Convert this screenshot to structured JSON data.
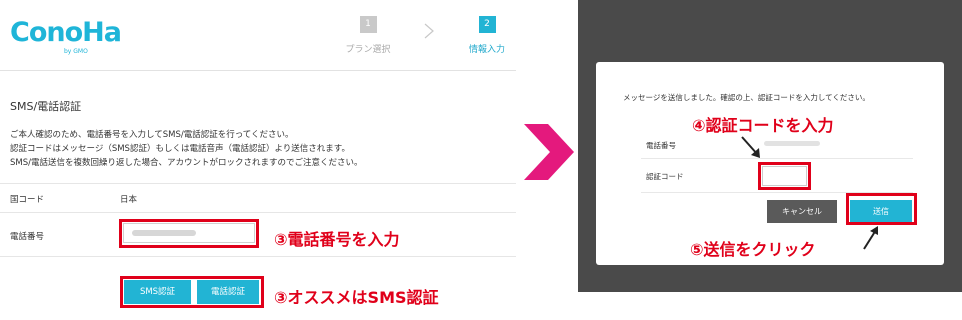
{
  "logo": {
    "text": "ConoHa",
    "sub": "by GMO"
  },
  "steps": [
    {
      "number": "1",
      "label": "プラン選択",
      "active": false
    },
    {
      "number": "2",
      "label": "情報入力",
      "active": true
    }
  ],
  "section_title": "SMS/電話認証",
  "description": [
    "ご本人確認のため、電話番号を入力してSMS/電話認証を行ってください。",
    "認証コードはメッセージ（SMS認証）もしくは電話音声（電話認証）より送信されます。",
    "SMS/電話送信を複数回繰り返した場合、アカウントがロックされますのでご注意ください。"
  ],
  "country": {
    "label": "国コード",
    "value": "日本"
  },
  "phone": {
    "label": "電話番号"
  },
  "auth_buttons": {
    "sms": "SMS認証",
    "phone": "電話認証"
  },
  "annotations": {
    "a3_phone": "③電話番号を入力",
    "a3_sms": "③オススメはSMS認証",
    "a4_code": "④認証コードを入力",
    "a5_send": "⑤送信をクリック"
  },
  "modal": {
    "message": "メッセージを送信しました。確認の上、認証コードを入力してください。",
    "phone_label": "電話番号",
    "code_label": "認証コード",
    "cancel": "キャンセル",
    "send": "送信"
  },
  "colors": {
    "accent": "#22b4d4",
    "highlight": "#e0001a",
    "chevron": "#e4197d",
    "overlay": "#4a4a4a"
  }
}
